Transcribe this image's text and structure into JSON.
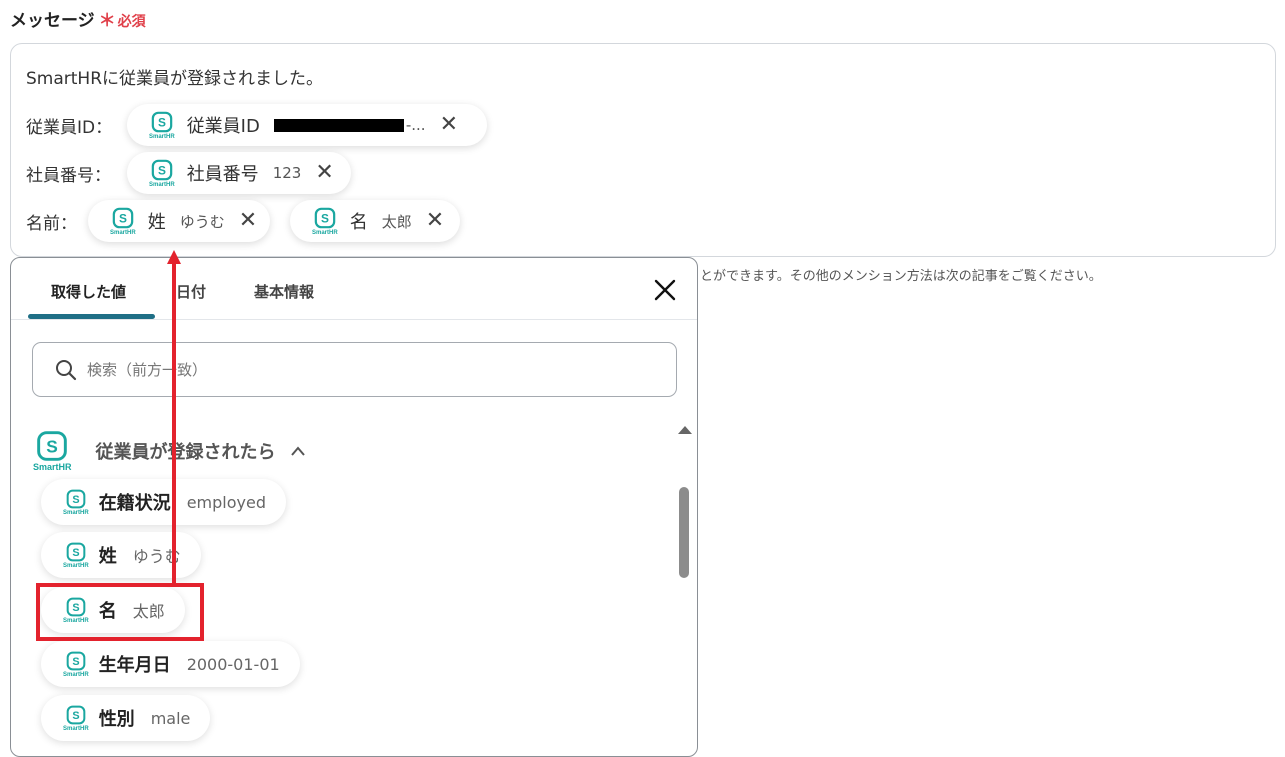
{
  "field": {
    "label": "メッセージ",
    "required_star": "＊",
    "required_text": "必須"
  },
  "editor": {
    "line1": "SmartHRに従業員が登録されました。",
    "line2_label": "従業員ID：",
    "line3_label": "社員番号：",
    "line4_label": "名前：",
    "pills": [
      {
        "name": "従業員ID",
        "value": "-..."
      },
      {
        "name": "社員番号",
        "value": "123"
      },
      {
        "name": "姓",
        "value": "ゆうむ"
      },
      {
        "name": "名",
        "value": "太郎"
      }
    ]
  },
  "helper_text": "とができます。その他のメンション方法は次の記事をご覧ください。",
  "dropdown": {
    "tabs": [
      "取得した値",
      "日付",
      "基本情報"
    ],
    "active_tab": 0,
    "search_placeholder": "検索（前方一致）",
    "group_title": "従業員が登録されたら",
    "items": [
      {
        "name": "在籍状況",
        "value": "employed"
      },
      {
        "name": "姓",
        "value": "ゆうむ"
      },
      {
        "name": "名",
        "value": "太郎"
      },
      {
        "name": "生年月日",
        "value": "2000-01-01"
      },
      {
        "name": "性別",
        "value": "male"
      }
    ]
  },
  "logo_caption": "SmartHR",
  "icons": [
    "smarthr-logo-icon",
    "close-icon",
    "search-icon",
    "chevron-up-icon",
    "scroll-up-icon"
  ],
  "colors": {
    "accent": "#1f6f86",
    "required": "#e0404a",
    "highlight": "#e3222d",
    "logo": "#1aa7a0"
  }
}
